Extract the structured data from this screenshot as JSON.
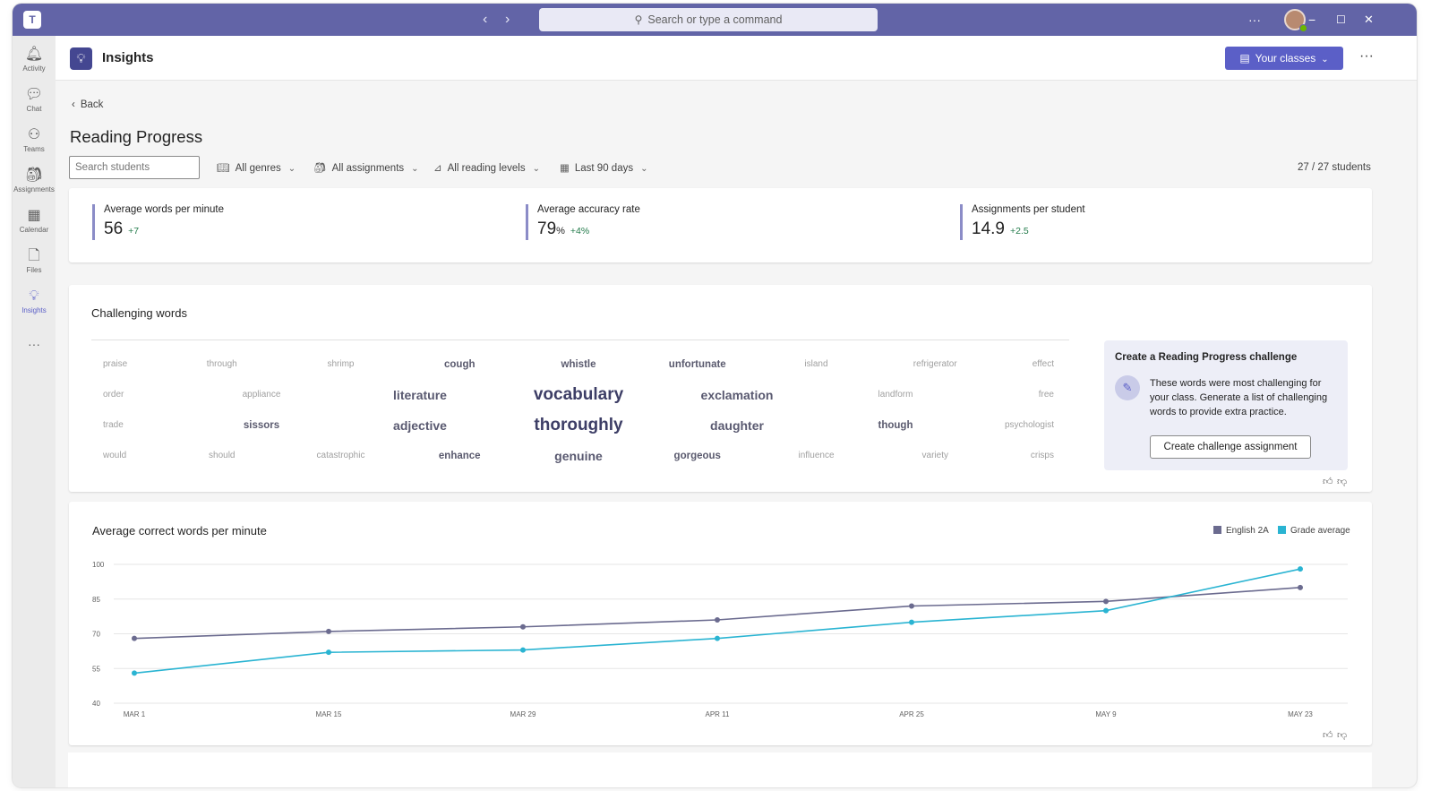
{
  "titlebar": {
    "search_placeholder": "Search or type a command",
    "more": "···",
    "minimize": "−",
    "maximize": "☐",
    "close": "✕"
  },
  "rail": [
    {
      "label": "Activity",
      "icon": "bell-icon",
      "glyph": "🔔︎"
    },
    {
      "label": "Chat",
      "icon": "chat-icon",
      "glyph": "💬︎"
    },
    {
      "label": "Teams",
      "icon": "teams-icon",
      "glyph": "⚇"
    },
    {
      "label": "Assignments",
      "icon": "assignments-icon",
      "glyph": "🎒︎"
    },
    {
      "label": "Calendar",
      "icon": "calendar-icon",
      "glyph": "▦"
    },
    {
      "label": "Files",
      "icon": "files-icon",
      "glyph": "🗋"
    },
    {
      "label": "Insights",
      "icon": "insights-icon",
      "glyph": "💡︎"
    }
  ],
  "rail_more": "···",
  "header": {
    "title": "Insights",
    "classes_button": "Your classes",
    "more": "···"
  },
  "back_label": "Back",
  "page_title": "Reading Progress",
  "search_students_placeholder": "Search students",
  "filters": [
    {
      "label": "All genres",
      "icon": "book-icon",
      "glyph": "📖︎"
    },
    {
      "label": "All assignments",
      "icon": "backpack-icon",
      "glyph": "🎒︎"
    },
    {
      "label": "All reading levels",
      "icon": "level-icon",
      "glyph": "⊿"
    },
    {
      "label": "Last 90 days",
      "icon": "calendar-icon",
      "glyph": "▦"
    }
  ],
  "student_count": "27 / 27 students",
  "metrics": [
    {
      "label": "Average words per minute",
      "value": "56",
      "unit": "",
      "delta": "+7"
    },
    {
      "label": "Average accuracy rate",
      "value": "79",
      "unit": "%",
      "delta": "+4%"
    },
    {
      "label": "Assignments per student",
      "value": "14.9",
      "unit": "",
      "delta": "+2.5"
    }
  ],
  "challenging_words": {
    "title": "Challenging words",
    "rows": [
      [
        {
          "w": "praise",
          "s": 1
        },
        {
          "w": "through",
          "s": 1
        },
        {
          "w": "shrimp",
          "s": 1
        },
        {
          "w": "cough",
          "s": 2
        },
        {
          "w": "whistle",
          "s": 2
        },
        {
          "w": "unfortunate",
          "s": 2
        },
        {
          "w": "island",
          "s": 1
        },
        {
          "w": "refrigerator",
          "s": 1
        },
        {
          "w": "effect",
          "s": 1
        }
      ],
      [
        {
          "w": "order",
          "s": 1
        },
        {
          "w": "appliance",
          "s": 1
        },
        {
          "w": "literature",
          "s": 3
        },
        {
          "w": "vocabulary",
          "s": 4
        },
        {
          "w": "exclamation",
          "s": 3
        },
        {
          "w": "landform",
          "s": 1
        },
        {
          "w": "free",
          "s": 1
        }
      ],
      [
        {
          "w": "trade",
          "s": 1
        },
        {
          "w": "sissors",
          "s": 2
        },
        {
          "w": "adjective",
          "s": 3
        },
        {
          "w": "thoroughly",
          "s": 4
        },
        {
          "w": "daughter",
          "s": 3
        },
        {
          "w": "though",
          "s": 2
        },
        {
          "w": "psychologist",
          "s": 1
        }
      ],
      [
        {
          "w": "would",
          "s": 1
        },
        {
          "w": "should",
          "s": 1
        },
        {
          "w": "catastrophic",
          "s": 1
        },
        {
          "w": "enhance",
          "s": 2
        },
        {
          "w": "genuine",
          "s": 3
        },
        {
          "w": "gorgeous",
          "s": 2
        },
        {
          "w": "influence",
          "s": 1
        },
        {
          "w": "variety",
          "s": 1
        },
        {
          "w": "crisps",
          "s": 1
        }
      ]
    ]
  },
  "challenge_panel": {
    "title": "Create a Reading Progress challenge",
    "text": "These words were most challenging for your class. Generate a list of challenging words to provide extra practice.",
    "button": "Create challenge assignment"
  },
  "feedback": {
    "like": "👍︎",
    "dislike": "👎︎"
  },
  "colors": {
    "accent": "#6264a7",
    "series_class": "#6b6b8f",
    "series_grade": "#2ab4d2",
    "positive": "#237b4b"
  },
  "chart_data": {
    "type": "line",
    "title": "Average correct words per minute",
    "xlabel": "",
    "ylabel": "",
    "x": [
      "MAR 1",
      "MAR 15",
      "MAR 29",
      "APR 11",
      "APR 25",
      "MAY 9",
      "MAY 23"
    ],
    "yticks": [
      100,
      85,
      70,
      55,
      40
    ],
    "ylim": [
      40,
      100
    ],
    "grid": true,
    "legend": "top-right",
    "series": [
      {
        "name": "English 2A",
        "color": "#6b6b8f",
        "values": [
          68,
          71,
          73,
          76,
          82,
          84,
          90
        ]
      },
      {
        "name": "Grade average",
        "color": "#2ab4d2",
        "values": [
          53,
          62,
          63,
          68,
          75,
          80,
          98
        ]
      }
    ]
  }
}
